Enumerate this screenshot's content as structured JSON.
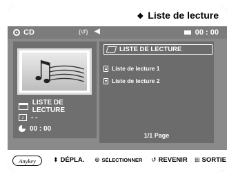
{
  "header": {
    "title": "Liste de lecture",
    "title_icon": "diamond-icon"
  },
  "status": {
    "media": "CD",
    "repeat": "(↺)",
    "time": "00 : 00"
  },
  "left_pane": {
    "folder_label": "LISTE DE LECTURE",
    "track": "- -",
    "elapsed": "00 : 00"
  },
  "list": {
    "selected_label": "LISTE DE LECTURE",
    "items": [
      "Liste de lecture 1",
      "Liste de lecture 2"
    ]
  },
  "pagination": "1/1 Page",
  "footer": {
    "anykey": "Anykey",
    "move": "DÉPLA.",
    "select": "SÉLECTIONNER",
    "return": "REVENIR",
    "exit": "SORTIE"
  },
  "colors": {
    "panel": "#8a8a8a",
    "list_bg": "#6c6c6c",
    "info_bg": "#6f6f6f",
    "header_bg": "#ffffff"
  }
}
